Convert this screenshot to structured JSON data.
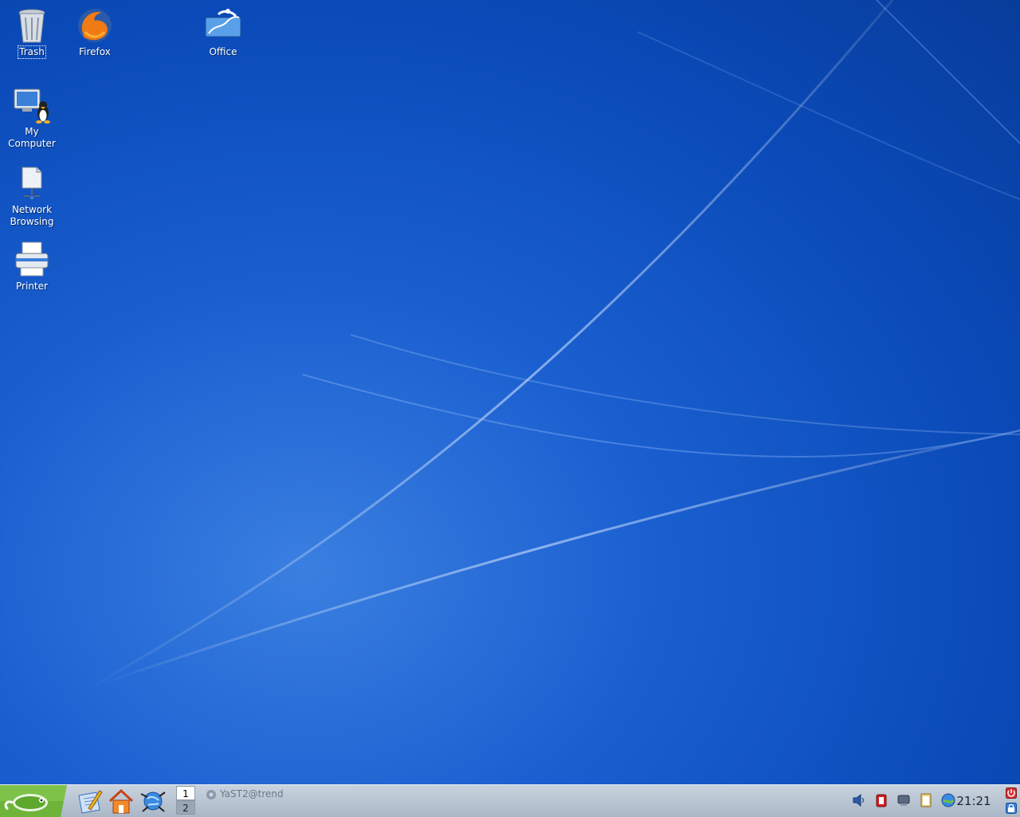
{
  "desktop": {
    "icons": [
      {
        "label": "Trash"
      },
      {
        "label": "Firefox"
      },
      {
        "label": "Office"
      },
      {
        "label_line1": "My",
        "label_line2": "Computer"
      },
      {
        "label_line1": "Network",
        "label_line2": "Browsing"
      },
      {
        "label": "Printer"
      }
    ]
  },
  "panel": {
    "pager": [
      "1",
      "2"
    ],
    "taskbar": {
      "label": "YaST2@trend"
    },
    "clock": "21:21"
  },
  "colors": {
    "wallpaper": "#0a4ab8",
    "panel": "#aab7c6"
  }
}
